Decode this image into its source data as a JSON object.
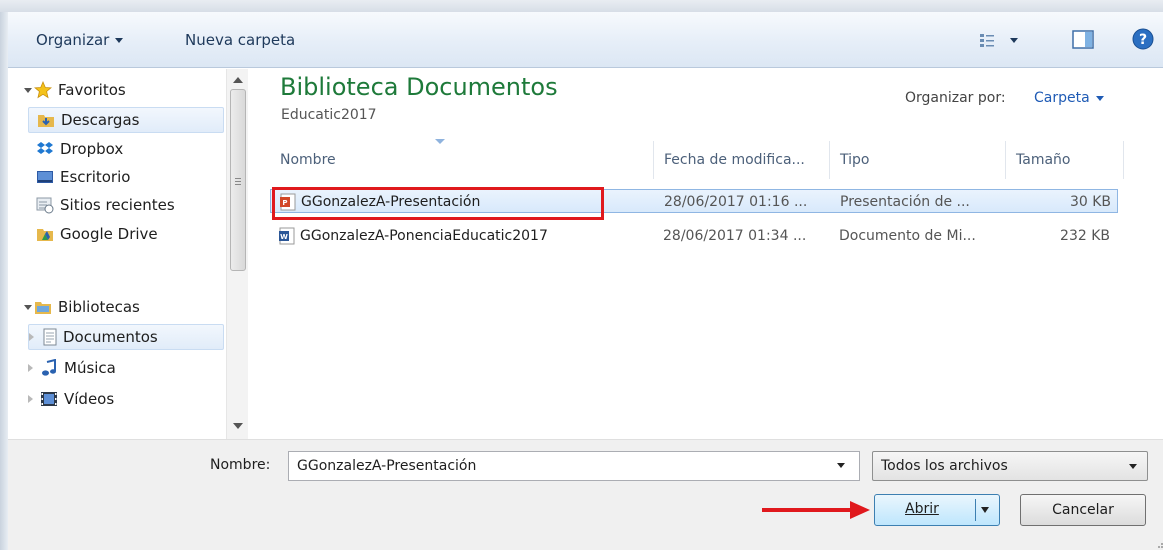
{
  "toolbar": {
    "organizar_label": "Organizar",
    "nueva_carpeta_label": "Nueva carpeta",
    "icons": [
      "view-options-icon",
      "preview-pane-icon",
      "help-icon"
    ]
  },
  "nav": {
    "favoritos": {
      "label": "Favoritos",
      "items": [
        {
          "label": "Descargas",
          "icon": "downloads-folder-icon",
          "selected": true
        },
        {
          "label": "Dropbox",
          "icon": "dropbox-icon"
        },
        {
          "label": "Escritorio",
          "icon": "desktop-icon"
        },
        {
          "label": "Sitios recientes",
          "icon": "recent-places-icon"
        },
        {
          "label": "Google Drive",
          "icon": "google-drive-icon"
        }
      ]
    },
    "bibliotecas": {
      "label": "Bibliotecas",
      "items": [
        {
          "label": "Documentos",
          "icon": "documents-icon",
          "selected": true
        },
        {
          "label": "Música",
          "icon": "music-icon"
        },
        {
          "label": "Vídeos",
          "icon": "videos-icon"
        }
      ]
    }
  },
  "content": {
    "title": "Biblioteca Documentos",
    "subtitle": "Educatic2017",
    "arrange_label": "Organizar por:",
    "arrange_value": "Carpeta",
    "columns": [
      "Nombre",
      "Fecha de modifica...",
      "Tipo",
      "Tamaño"
    ],
    "files": [
      {
        "name": "GGonzalezA-Presentación",
        "date": "28/06/2017 01:16 ...",
        "type": "Presentación de ...",
        "size": "30 KB",
        "icon": "powerpoint-file-icon",
        "selected": true
      },
      {
        "name": "GGonzalezA-PonenciaEducatic2017",
        "date": "28/06/2017 01:34 ...",
        "type": "Documento de Mi...",
        "size": "232 KB",
        "icon": "word-file-icon",
        "selected": false
      }
    ]
  },
  "bottom": {
    "filename_label": "Nombre:",
    "filename_value": "GGonzalezA-Presentación",
    "filter_value": "Todos los archivos",
    "open_label": "Abrir",
    "cancel_label": "Cancelar"
  },
  "colors": {
    "title_green": "#1e7a3a",
    "link_blue": "#1f5bb5",
    "annotation_red": "#e0191d"
  }
}
